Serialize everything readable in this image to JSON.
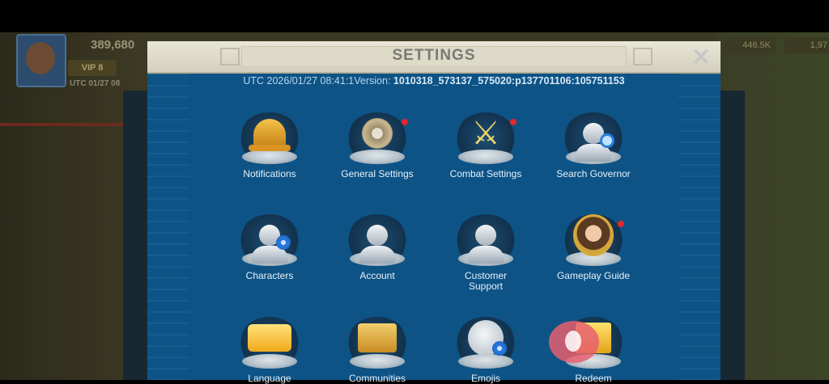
{
  "hud": {
    "power": "389,680",
    "vip": "VIP 8",
    "utc_time": "UTC 01/27 08",
    "gold": "446.5K",
    "gems": "1,97"
  },
  "settings": {
    "title": "SETTINGS",
    "close_icon": "close-icon",
    "utc_prefix": "UTC 2026/01/27 08:41:1",
    "version_label": "Version:",
    "version_value": "1010318_573137_575020:p137701106:105751153",
    "items": [
      {
        "label": "Notifications",
        "icon": "bell-icon",
        "badge": false
      },
      {
        "label": "General Settings",
        "icon": "gears-icon",
        "badge": true
      },
      {
        "label": "Combat Settings",
        "icon": "crossed-swords-icon",
        "badge": true
      },
      {
        "label": "Search Governor",
        "icon": "search-governor-icon",
        "badge": false
      },
      {
        "label": "Characters",
        "icon": "characters-icon",
        "badge": false
      },
      {
        "label": "Account",
        "icon": "account-icon",
        "badge": false
      },
      {
        "label": "Customer\nSupport",
        "icon": "customer-support-icon",
        "badge": false
      },
      {
        "label": "Gameplay Guide",
        "icon": "gameplay-guide-icon",
        "badge": true
      },
      {
        "label": "Language",
        "icon": "language-icon",
        "badge": false
      },
      {
        "label": "Communities",
        "icon": "communities-icon",
        "badge": false
      },
      {
        "label": "Emojis",
        "icon": "emojis-icon",
        "badge": false
      },
      {
        "label": "Redeem",
        "icon": "redeem-gift-icon",
        "badge": false
      }
    ]
  },
  "colors": {
    "panel": "#0d5386",
    "badge": "#e4262a",
    "title_bar": "#e9e6d8"
  }
}
